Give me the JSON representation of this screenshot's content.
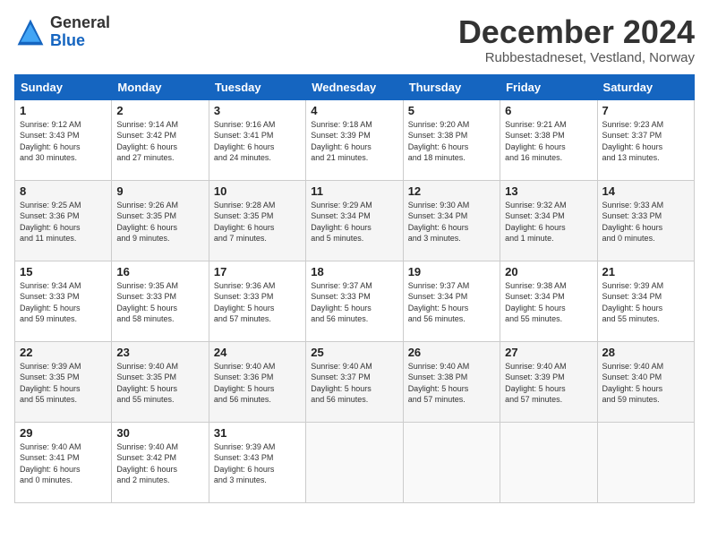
{
  "logo": {
    "general": "General",
    "blue": "Blue"
  },
  "header": {
    "month": "December 2024",
    "location": "Rubbestadneset, Vestland, Norway"
  },
  "weekdays": [
    "Sunday",
    "Monday",
    "Tuesday",
    "Wednesday",
    "Thursday",
    "Friday",
    "Saturday"
  ],
  "weeks": [
    [
      {
        "day": "1",
        "info": "Sunrise: 9:12 AM\nSunset: 3:43 PM\nDaylight: 6 hours\nand 30 minutes."
      },
      {
        "day": "2",
        "info": "Sunrise: 9:14 AM\nSunset: 3:42 PM\nDaylight: 6 hours\nand 27 minutes."
      },
      {
        "day": "3",
        "info": "Sunrise: 9:16 AM\nSunset: 3:41 PM\nDaylight: 6 hours\nand 24 minutes."
      },
      {
        "day": "4",
        "info": "Sunrise: 9:18 AM\nSunset: 3:39 PM\nDaylight: 6 hours\nand 21 minutes."
      },
      {
        "day": "5",
        "info": "Sunrise: 9:20 AM\nSunset: 3:38 PM\nDaylight: 6 hours\nand 18 minutes."
      },
      {
        "day": "6",
        "info": "Sunrise: 9:21 AM\nSunset: 3:38 PM\nDaylight: 6 hours\nand 16 minutes."
      },
      {
        "day": "7",
        "info": "Sunrise: 9:23 AM\nSunset: 3:37 PM\nDaylight: 6 hours\nand 13 minutes."
      }
    ],
    [
      {
        "day": "8",
        "info": "Sunrise: 9:25 AM\nSunset: 3:36 PM\nDaylight: 6 hours\nand 11 minutes."
      },
      {
        "day": "9",
        "info": "Sunrise: 9:26 AM\nSunset: 3:35 PM\nDaylight: 6 hours\nand 9 minutes."
      },
      {
        "day": "10",
        "info": "Sunrise: 9:28 AM\nSunset: 3:35 PM\nDaylight: 6 hours\nand 7 minutes."
      },
      {
        "day": "11",
        "info": "Sunrise: 9:29 AM\nSunset: 3:34 PM\nDaylight: 6 hours\nand 5 minutes."
      },
      {
        "day": "12",
        "info": "Sunrise: 9:30 AM\nSunset: 3:34 PM\nDaylight: 6 hours\nand 3 minutes."
      },
      {
        "day": "13",
        "info": "Sunrise: 9:32 AM\nSunset: 3:34 PM\nDaylight: 6 hours\nand 1 minute."
      },
      {
        "day": "14",
        "info": "Sunrise: 9:33 AM\nSunset: 3:33 PM\nDaylight: 6 hours\nand 0 minutes."
      }
    ],
    [
      {
        "day": "15",
        "info": "Sunrise: 9:34 AM\nSunset: 3:33 PM\nDaylight: 5 hours\nand 59 minutes."
      },
      {
        "day": "16",
        "info": "Sunrise: 9:35 AM\nSunset: 3:33 PM\nDaylight: 5 hours\nand 58 minutes."
      },
      {
        "day": "17",
        "info": "Sunrise: 9:36 AM\nSunset: 3:33 PM\nDaylight: 5 hours\nand 57 minutes."
      },
      {
        "day": "18",
        "info": "Sunrise: 9:37 AM\nSunset: 3:33 PM\nDaylight: 5 hours\nand 56 minutes."
      },
      {
        "day": "19",
        "info": "Sunrise: 9:37 AM\nSunset: 3:34 PM\nDaylight: 5 hours\nand 56 minutes."
      },
      {
        "day": "20",
        "info": "Sunrise: 9:38 AM\nSunset: 3:34 PM\nDaylight: 5 hours\nand 55 minutes."
      },
      {
        "day": "21",
        "info": "Sunrise: 9:39 AM\nSunset: 3:34 PM\nDaylight: 5 hours\nand 55 minutes."
      }
    ],
    [
      {
        "day": "22",
        "info": "Sunrise: 9:39 AM\nSunset: 3:35 PM\nDaylight: 5 hours\nand 55 minutes."
      },
      {
        "day": "23",
        "info": "Sunrise: 9:40 AM\nSunset: 3:35 PM\nDaylight: 5 hours\nand 55 minutes."
      },
      {
        "day": "24",
        "info": "Sunrise: 9:40 AM\nSunset: 3:36 PM\nDaylight: 5 hours\nand 56 minutes."
      },
      {
        "day": "25",
        "info": "Sunrise: 9:40 AM\nSunset: 3:37 PM\nDaylight: 5 hours\nand 56 minutes."
      },
      {
        "day": "26",
        "info": "Sunrise: 9:40 AM\nSunset: 3:38 PM\nDaylight: 5 hours\nand 57 minutes."
      },
      {
        "day": "27",
        "info": "Sunrise: 9:40 AM\nSunset: 3:39 PM\nDaylight: 5 hours\nand 57 minutes."
      },
      {
        "day": "28",
        "info": "Sunrise: 9:40 AM\nSunset: 3:40 PM\nDaylight: 5 hours\nand 59 minutes."
      }
    ],
    [
      {
        "day": "29",
        "info": "Sunrise: 9:40 AM\nSunset: 3:41 PM\nDaylight: 6 hours\nand 0 minutes."
      },
      {
        "day": "30",
        "info": "Sunrise: 9:40 AM\nSunset: 3:42 PM\nDaylight: 6 hours\nand 2 minutes."
      },
      {
        "day": "31",
        "info": "Sunrise: 9:39 AM\nSunset: 3:43 PM\nDaylight: 6 hours\nand 3 minutes."
      },
      null,
      null,
      null,
      null
    ]
  ]
}
